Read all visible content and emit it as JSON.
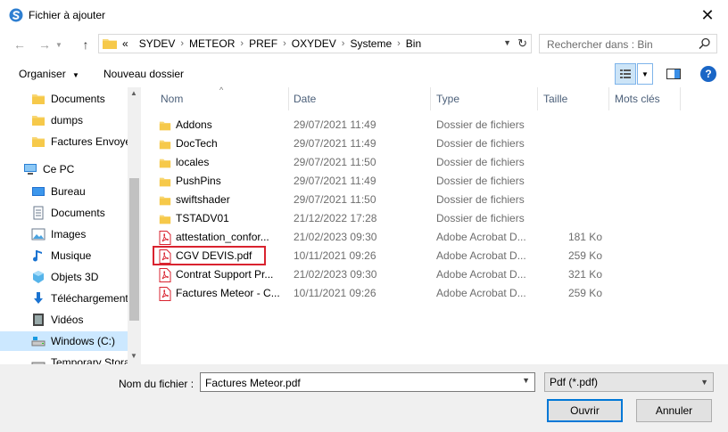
{
  "window": {
    "title": "Fichier à ajouter"
  },
  "address": {
    "overflow": "«",
    "crumbs": [
      "SYDEV",
      "METEOR",
      "PREF",
      "OXYDEV",
      "Systeme",
      "Bin"
    ]
  },
  "search": {
    "placeholder": "Rechercher dans : Bin"
  },
  "toolbar": {
    "organize_label": "Organiser",
    "new_folder_label": "Nouveau dossier"
  },
  "nav": {
    "items": [
      {
        "label": "Documents",
        "icon": "folder-icon"
      },
      {
        "label": "dumps",
        "icon": "folder-icon"
      },
      {
        "label": "Factures Envoye",
        "icon": "folder-icon"
      },
      {
        "label": "Ce PC",
        "icon": "computer-icon"
      },
      {
        "label": "Bureau",
        "icon": "desktop-icon"
      },
      {
        "label": "Documents",
        "icon": "documents-icon"
      },
      {
        "label": "Images",
        "icon": "images-icon"
      },
      {
        "label": "Musique",
        "icon": "music-icon"
      },
      {
        "label": "Objets 3D",
        "icon": "cube-icon"
      },
      {
        "label": "Téléchargement",
        "icon": "download-icon"
      },
      {
        "label": "Vidéos",
        "icon": "video-icon"
      },
      {
        "label": "Windows (C:)",
        "icon": "drive-icon"
      },
      {
        "label": "Temporary Stora",
        "icon": "drive-icon"
      }
    ],
    "selected_index": 11
  },
  "columns": {
    "name": "Nom",
    "date": "Date",
    "type": "Type",
    "size": "Taille",
    "tags": "Mots clés"
  },
  "files": [
    {
      "name": "Addons",
      "date": "29/07/2021 11:49",
      "type": "Dossier de fichiers",
      "size": "",
      "kind": "folder"
    },
    {
      "name": "DocTech",
      "date": "29/07/2021 11:49",
      "type": "Dossier de fichiers",
      "size": "",
      "kind": "folder"
    },
    {
      "name": "locales",
      "date": "29/07/2021 11:50",
      "type": "Dossier de fichiers",
      "size": "",
      "kind": "folder"
    },
    {
      "name": "PushPins",
      "date": "29/07/2021 11:49",
      "type": "Dossier de fichiers",
      "size": "",
      "kind": "folder"
    },
    {
      "name": "swiftshader",
      "date": "29/07/2021 11:50",
      "type": "Dossier de fichiers",
      "size": "",
      "kind": "folder"
    },
    {
      "name": "TSTADV01",
      "date": "21/12/2022 17:28",
      "type": "Dossier de fichiers",
      "size": "",
      "kind": "folder"
    },
    {
      "name": "attestation_confor...",
      "date": "21/02/2023 09:30",
      "type": "Adobe Acrobat D...",
      "size": "181 Ko",
      "kind": "pdf"
    },
    {
      "name": "CGV DEVIS.pdf",
      "date": "10/11/2021 09:26",
      "type": "Adobe Acrobat D...",
      "size": "259 Ko",
      "kind": "pdf"
    },
    {
      "name": "Contrat Support Pr...",
      "date": "21/02/2023 09:30",
      "type": "Adobe Acrobat D...",
      "size": "321 Ko",
      "kind": "pdf"
    },
    {
      "name": "Factures Meteor - C...",
      "date": "10/11/2021 09:26",
      "type": "Adobe Acrobat D...",
      "size": "259 Ko",
      "kind": "pdf"
    }
  ],
  "footer": {
    "filename_label": "Nom du fichier :",
    "filename_value": "Factures Meteor.pdf",
    "filetype_value": "Pdf (*.pdf)",
    "open_label": "Ouvrir",
    "cancel_label": "Annuler"
  },
  "colors": {
    "accent": "#0078d7",
    "highlight_border": "#d9232f",
    "folder": "#f8d775",
    "pdf": "#d9232f",
    "selected_bg": "#cce8ff"
  }
}
